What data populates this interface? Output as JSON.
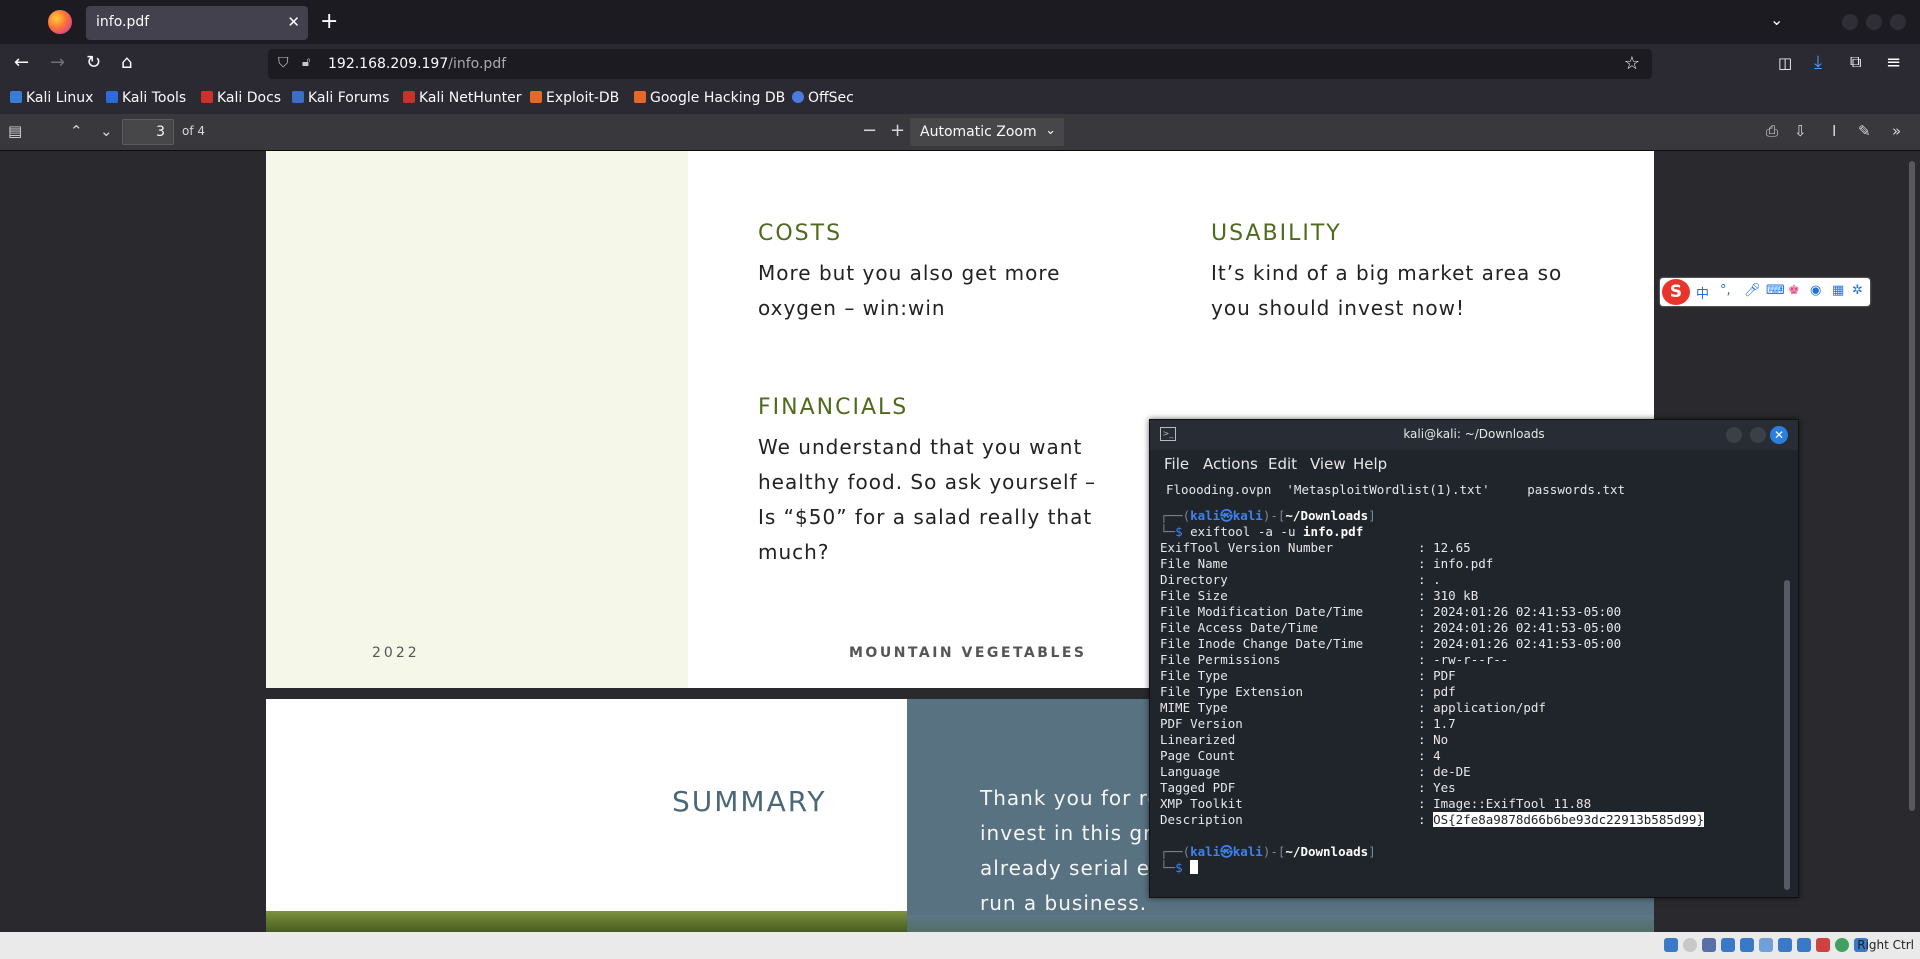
{
  "browser": {
    "tab_title": "info.pdf",
    "url_host": "192.168.209.197",
    "url_path": "/info.pdf",
    "bookmarks": [
      "Kali Linux",
      "Kali Tools",
      "Kali Docs",
      "Kali Forums",
      "Kali NetHunter",
      "Exploit-DB",
      "Google Hacking DB",
      "OffSec"
    ]
  },
  "pdf_toolbar": {
    "page_number": "3",
    "page_count": "of 4",
    "zoom": "Automatic Zoom"
  },
  "page3": {
    "costs_heading": "COSTS",
    "costs_line1": "More but you also get more",
    "costs_line2": "oxygen – win:win",
    "usability_heading": "USABILITY",
    "usability_line1": "It’s kind of a big market area so",
    "usability_line2": "you should invest now!",
    "financials_heading": "FINANCIALS",
    "financials_line1": "We understand that you want",
    "financials_line2": "healthy food. So ask yourself –",
    "financials_line3": "Is “$50” for a salad really that",
    "financials_line4": "much?",
    "footer_year": "2022",
    "footer_title": "MOUNTAIN VEGETABLES"
  },
  "page4": {
    "summary_heading": "SUMMARY",
    "line1": "Thank you for reading our brochure. You should",
    "line2": "invest in this great idea. Think about this. We are",
    "line3": "already serial entrepreneurs now and know how to",
    "line4": "run a business."
  },
  "terminal": {
    "title": "kali@kali: ~/Downloads",
    "menu": [
      "File",
      "Actions",
      "Edit",
      "View",
      "Help"
    ],
    "listing": "Floooding.ovpn  'MetasploitWordlist(1).txt'     passwords.txt",
    "prompt_user": "kali㉿kali",
    "prompt_dir": "~/Downloads",
    "command": "exiftool -a -u",
    "command_arg": "info.pdf",
    "rows": [
      {
        "key": "ExifTool Version Number",
        "value": "12.65"
      },
      {
        "key": "File Name",
        "value": "info.pdf"
      },
      {
        "key": "Directory",
        "value": "."
      },
      {
        "key": "File Size",
        "value": "310 kB"
      },
      {
        "key": "File Modification Date/Time",
        "value": "2024:01:26 02:41:53-05:00"
      },
      {
        "key": "File Access Date/Time",
        "value": "2024:01:26 02:41:53-05:00"
      },
      {
        "key": "File Inode Change Date/Time",
        "value": "2024:01:26 02:41:53-05:00"
      },
      {
        "key": "File Permissions",
        "value": "-rw-r--r--"
      },
      {
        "key": "File Type",
        "value": "PDF"
      },
      {
        "key": "File Type Extension",
        "value": "pdf"
      },
      {
        "key": "MIME Type",
        "value": "application/pdf"
      },
      {
        "key": "PDF Version",
        "value": "1.7"
      },
      {
        "key": "Linearized",
        "value": "No"
      },
      {
        "key": "Page Count",
        "value": "4"
      },
      {
        "key": "Language",
        "value": "de-DE"
      },
      {
        "key": "Tagged PDF",
        "value": "Yes"
      },
      {
        "key": "XMP Toolkit",
        "value": "Image::ExifTool 11.88"
      },
      {
        "key": "Description",
        "value": "OS{2fe8a9878d66b6be93dc22913b585d99}"
      }
    ]
  },
  "taskbar": {
    "right_label": "Right Ctrl"
  }
}
